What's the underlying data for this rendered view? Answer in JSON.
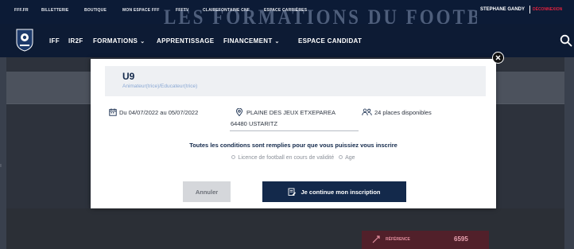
{
  "topbar": {
    "links": [
      "FFF.FR",
      "BILLETTERIE",
      "BOUTIQUE",
      "MON ESPACE FFF",
      "FFFTV",
      "CLAIREFONTAINE CNF",
      "ESPACE CARRIÈRES"
    ],
    "user_name": "STEPHANE GANDY",
    "logout_label": "DÉCONNEXION"
  },
  "banner": {
    "text": "LES FORMATIONS DU FOOTBALL FRANÇAIS"
  },
  "nav": {
    "items": [
      {
        "label": "IFF",
        "dropdown": false
      },
      {
        "label": "IR2F",
        "dropdown": false
      },
      {
        "label": "FORMATIONS",
        "dropdown": true
      },
      {
        "label": "APPRENTISSAGE",
        "dropdown": false
      },
      {
        "label": "FINANCEMENT",
        "dropdown": true
      },
      {
        "label": "ESPACE CANDIDAT",
        "dropdown": false
      }
    ],
    "chevron": "⌄",
    "search_icon": "search-icon"
  },
  "background": {
    "reference_label": "RÉFÉRENCE",
    "reference_value": "6595",
    "left_edge_mark": "ı"
  },
  "modal": {
    "close_glyph": "✕",
    "title": "U9",
    "subtitle": "Animateur(trice)/Educateur(trice)",
    "dates": "Du 04/07/2022 au 05/07/2022",
    "address_line1": "PLAINE DES JEUX ETXEPAREA",
    "address_line2": "64480 USTARITZ",
    "places": "24 places disponibles",
    "conditions_text": "Toutes les conditions sont remplies pour que vous puissiez vous inscrire",
    "requirements": [
      "Licence de football en cours de validité",
      "Age"
    ],
    "cancel_label": "Annuler",
    "continue_label": "Je continue mon inscription"
  },
  "colors": {
    "navy": "#13294b",
    "topbar": "#0c1b36",
    "logout": "#e0223f",
    "subtitle": "#8aa8d4",
    "reference_bg": "#51202a"
  }
}
